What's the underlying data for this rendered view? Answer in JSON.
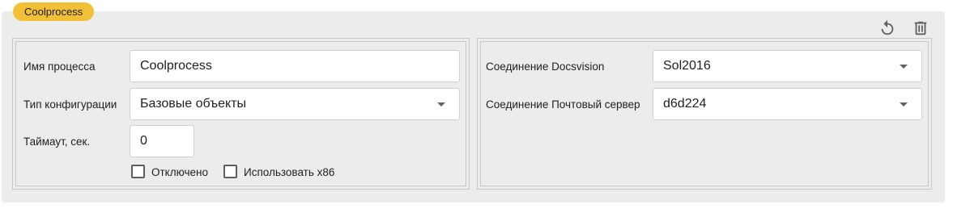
{
  "header": {
    "badge_label": "Coolprocess",
    "badge_color": "#f2c037",
    "icons": [
      "reset-icon",
      "trash-icon"
    ]
  },
  "left_panel": {
    "process_name_label": "Имя процесса",
    "process_name_value": "Coolprocess",
    "config_type_label": "Тип конфигурации",
    "config_type_value": "Базовые объекты",
    "timeout_label": "Таймаут, сек.",
    "timeout_value": "0",
    "disabled_label": "Отключено",
    "use_x86_label": "Использовать x86"
  },
  "right_panel": {
    "docsvision_label": "Соединение Docsvision",
    "docsvision_value": "Sol2016",
    "mail_server_label": "Соединение Почтовый сервер",
    "mail_server_value": "d6d224"
  }
}
